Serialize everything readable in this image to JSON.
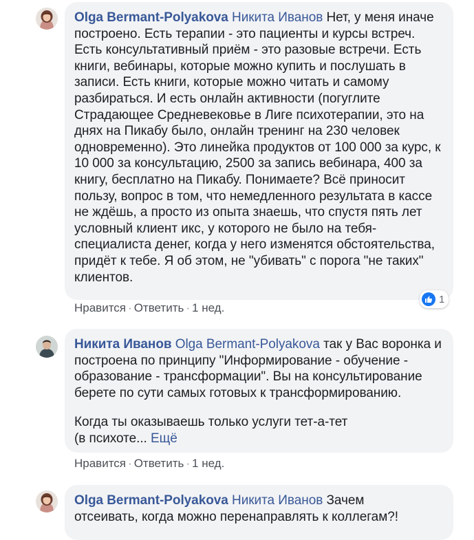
{
  "colors": {
    "link": "#385898",
    "bubble": "#f2f3f5",
    "like": "#1877f2",
    "meta": "#90949c"
  },
  "comments": [
    {
      "author": "Olga Bermant-Polyakova",
      "mention": "Никита Иванов",
      "text": "Нет, у меня иначе построено. Есть терапии - это пациенты и курсы встреч. Есть консультативный приём - это разовые встречи. Есть книги, вебинары, которые можно купить и послушать в записи. Есть книги, которые можно читать и самому разбираться. И есть онлайн активности (погуглите Страдающее Средневековье в Лиге психотерапии, это на днях на Пикабу было, онлайн тренинг на 230 человек одновременно). Это линейка продуктов от 100 000 за курс, к 10 000 за консультацию, 2500 за запись вебинара, 400 за книгу, бесплатно на Пикабу. Понимаете? Всё приносит пользу, вопрос в том, что немедленного результата в кассе не ждёшь, а просто из опыта знаешь, что спустя пять лет условный клиент икс, у которого не было на тебя-специалиста денег, когда у него изменятся обстоятельства, придёт к тебе. Я об этом, не \"убивать\" с порога \"не таких\" клиентов.",
      "like_label": "Нравится",
      "reply_label": "Ответить",
      "time": "1 нед.",
      "reaction_count": "1",
      "reaction_icon": "like-icon",
      "avatar_icon": "user-avatar-woman"
    },
    {
      "author": "Никита Иванов",
      "mention": "Olga Bermant-Polyakova",
      "text": "так у Вас воронка и построена по принципу \"Информирование - обучение - образование - трансформации\". Вы на консультирование берете по сути самых готовых к трансформированию.",
      "text2": "Когда ты оказываешь только услуги тет-а-тет (в психоте...",
      "more_label": "Ещё",
      "like_label": "Нравится",
      "reply_label": "Ответить",
      "time": "1 нед.",
      "avatar_icon": "user-avatar-man"
    },
    {
      "author": "Olga Bermant-Polyakova",
      "mention": "Никита Иванов",
      "text": "Зачем отсеивать, когда можно перенаправлять к коллегам?!",
      "avatar_icon": "user-avatar-woman"
    }
  ]
}
